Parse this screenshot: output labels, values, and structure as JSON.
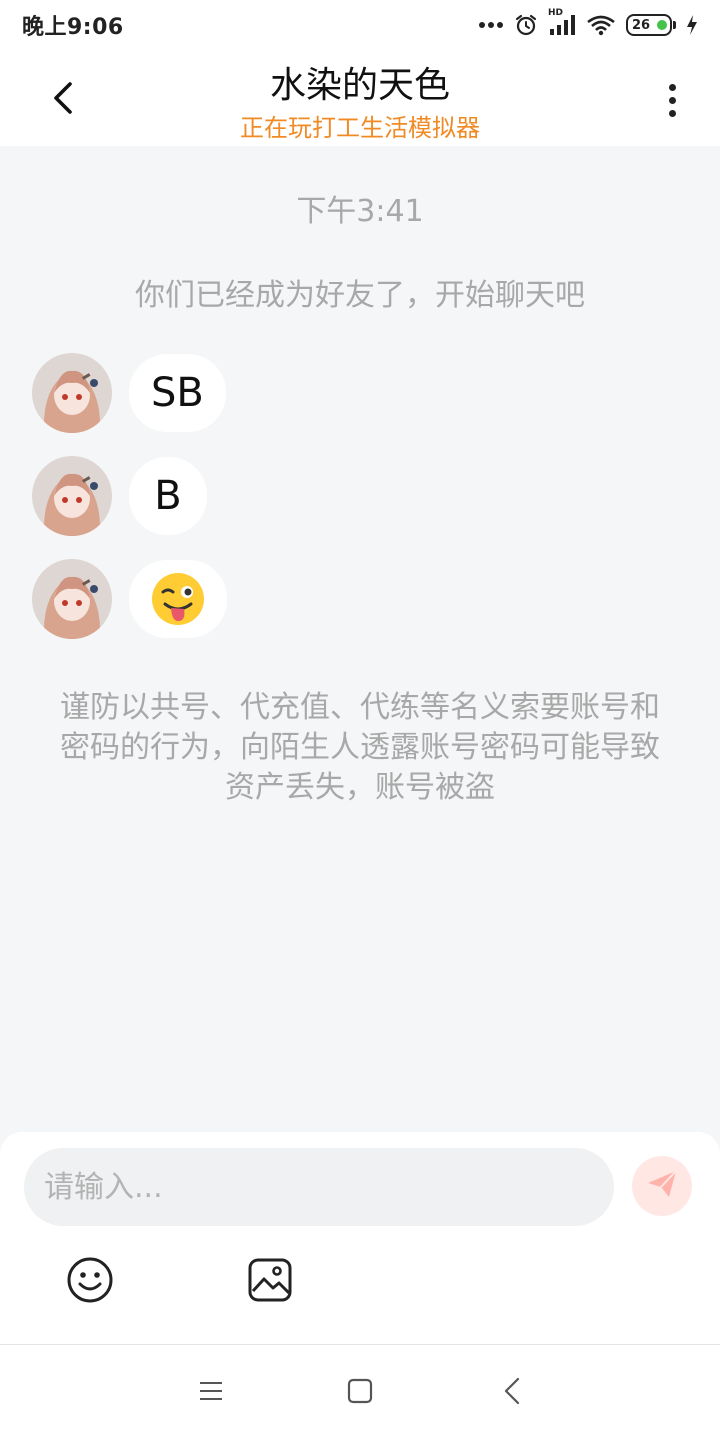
{
  "status_bar": {
    "time": "晚上9:06",
    "network_label": "HD",
    "battery_level": "26",
    "icons": [
      "more-dots-icon",
      "alarm-icon",
      "signal-icon",
      "wifi-icon",
      "battery-icon",
      "charging-icon"
    ]
  },
  "header": {
    "title": "水染的天色",
    "subtitle": "正在玩打工生活模拟器",
    "back_icon": "chevron-left-icon",
    "more_icon": "more-vertical-icon"
  },
  "chat": {
    "timestamp": "下午3:41",
    "system_message": "你们已经成为好友了，开始聊天吧",
    "messages": [
      {
        "sender": "other",
        "text": "SB"
      },
      {
        "sender": "other",
        "text": "B"
      },
      {
        "sender": "other",
        "text": "😜"
      }
    ],
    "warning": "谨防以共号、代充值、代练等名义索要账号和密码的行为，向陌生人透露账号密码可能导致资产丢失，账号被盗"
  },
  "input": {
    "placeholder": "请输入...",
    "value": "",
    "send_icon": "send-icon",
    "tools": [
      "emoji-icon",
      "image-icon"
    ]
  },
  "nav_bar": {
    "icons": [
      "menu-icon",
      "home-square-icon",
      "back-triangle-icon"
    ]
  },
  "colors": {
    "accent": "#f08a24",
    "background": "#f4f6f7",
    "muted_text": "#a8a8a8",
    "send_button": "#ffe7e4"
  }
}
